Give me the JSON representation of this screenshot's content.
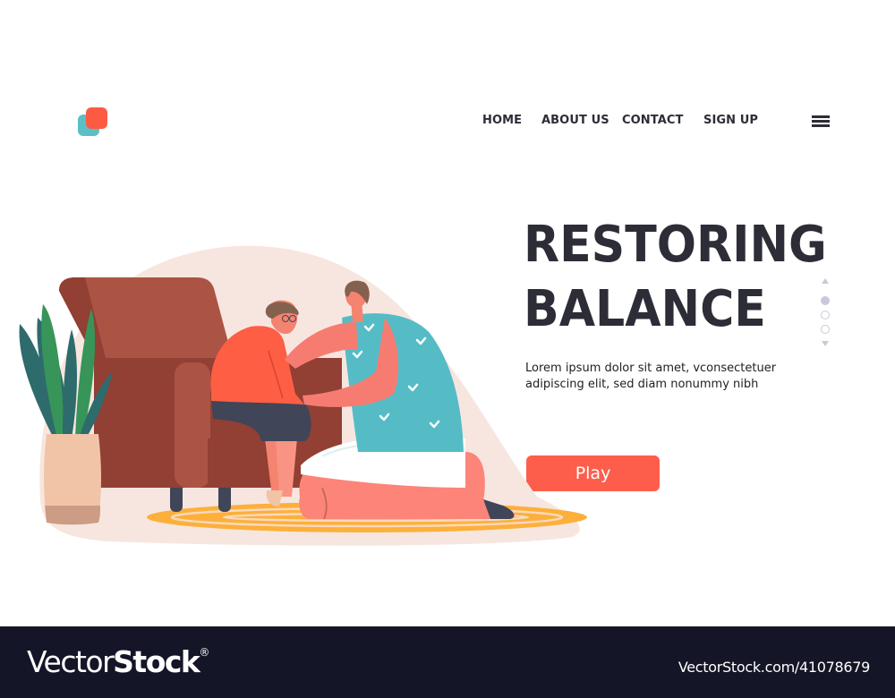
{
  "header": {
    "logo": "brand-logo-squares",
    "nav": [
      {
        "label": "HOME"
      },
      {
        "label": "ABOUT US"
      },
      {
        "label": "CONTACT"
      },
      {
        "label": "SIGN UP"
      }
    ],
    "menu_icon": "hamburger-menu-icon"
  },
  "hero": {
    "title_line1": "RESTORING",
    "title_line2": "BALANCE",
    "description": "Lorem ipsum dolor sit amet, vconsectetuer adipiscing elit, sed diam nonummy nibh",
    "cta_label": "Play",
    "pager": {
      "total": 3,
      "active": 1
    }
  },
  "illustration": {
    "description": "Woman kneeling on rug helping girl with glasses sitting on armchair, potted plant beside"
  },
  "colors": {
    "accent": "#fd5e4b",
    "logo_teal": "#5cbfc6",
    "logo_coral": "#fd5a44",
    "text_dark": "#2d2d38",
    "footer_bg": "#141527",
    "pager": "#c9c9da"
  },
  "footer": {
    "brand_light": "Vector",
    "brand_bold": "Stock",
    "brand_mark": "®",
    "reference": "VectorStock.com/41078679"
  }
}
